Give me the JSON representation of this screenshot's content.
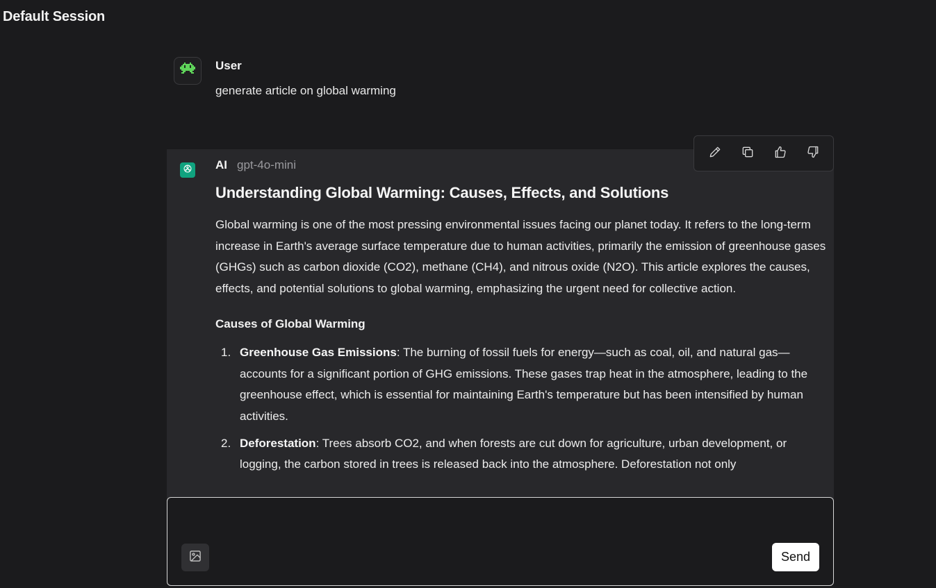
{
  "session": {
    "title": "Default Session"
  },
  "user_message": {
    "author": "User",
    "text": "generate article on global warming",
    "avatar_icon": "alien-invader-icon"
  },
  "ai_message": {
    "author": "AI",
    "model": "gpt-4o-mini",
    "avatar_icon": "openai-logo-icon",
    "title": "Understanding Global Warming: Causes, Effects, and Solutions",
    "intro": "Global warming is one of the most pressing environmental issues facing our planet today. It refers to the long-term increase in Earth's average surface temperature due to human activities, primarily the emission of greenhouse gases (GHGs) such as carbon dioxide (CO2), methane (CH4), and nitrous oxide (N2O). This article explores the causes, effects, and potential solutions to global warming, emphasizing the urgent need for collective action.",
    "section_heading": "Causes of Global Warming",
    "items": [
      {
        "num": "1.",
        "term": "Greenhouse Gas Emissions",
        "text": ": The burning of fossil fuels for energy—such as coal, oil, and natural gas—accounts for a significant portion of GHG emissions. These gases trap heat in the atmosphere, leading to the greenhouse effect, which is essential for maintaining Earth's temperature but has been intensified by human activities."
      },
      {
        "num": "2.",
        "term": "Deforestation",
        "text": ": Trees absorb CO2, and when forests are cut down for agriculture, urban development, or logging, the carbon stored in trees is released back into the atmosphere. Deforestation not only"
      }
    ]
  },
  "message_actions": {
    "edit": "pencil-icon",
    "copy": "copy-icon",
    "like": "thumbs-up-icon",
    "dislike": "thumbs-down-icon"
  },
  "composer": {
    "placeholder": "",
    "image_button_icon": "image-icon",
    "send_label": "Send"
  },
  "colors": {
    "background": "#1b1b1d",
    "ai_panel": "#28282b",
    "ai_avatar": "#10a37f",
    "alien_green": "#5fd35a"
  }
}
